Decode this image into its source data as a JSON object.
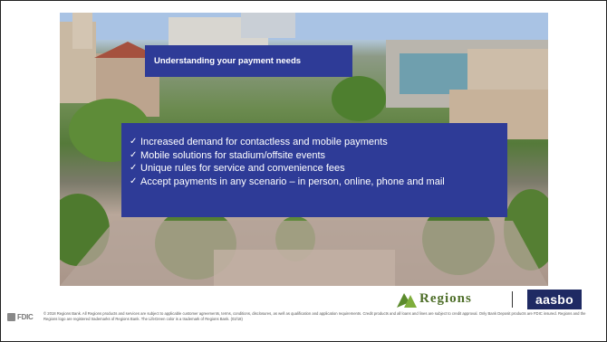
{
  "slide": {
    "title": "Understanding your payment needs",
    "bullets": [
      "Increased demand for contactless and mobile payments",
      "Mobile solutions for stadium/offsite events",
      "Unique rules for service and convenience fees",
      "Accept payments in any scenario – in person, online, phone and mail"
    ],
    "check_glyph": "✓"
  },
  "footer": {
    "fdic_label": "FDIC",
    "disclaimer": "© 2018 Regions Bank. All Regions products and services are subject to applicable customer agreements, terms, conditions, disclosures, as well as qualification and application requirements. Credit products and all loans and lines are subject to credit approval. Only Bank Deposit products are FDIC insured. Regions and the Regions logo are registered trademarks of Regions Bank. The LifeGreen color is a trademark of Regions Bank. (02/18)",
    "regions_logo_text": "Regions",
    "aasbo_logo_text": "aasbo"
  },
  "colors": {
    "box_blue": "#2e3b97",
    "regions_green": "#4f6f2a",
    "aasbo_navy": "#1f2a63"
  },
  "icons": [
    "checkmark-icon",
    "regions-triangle-icon",
    "fdic-seal-icon"
  ]
}
